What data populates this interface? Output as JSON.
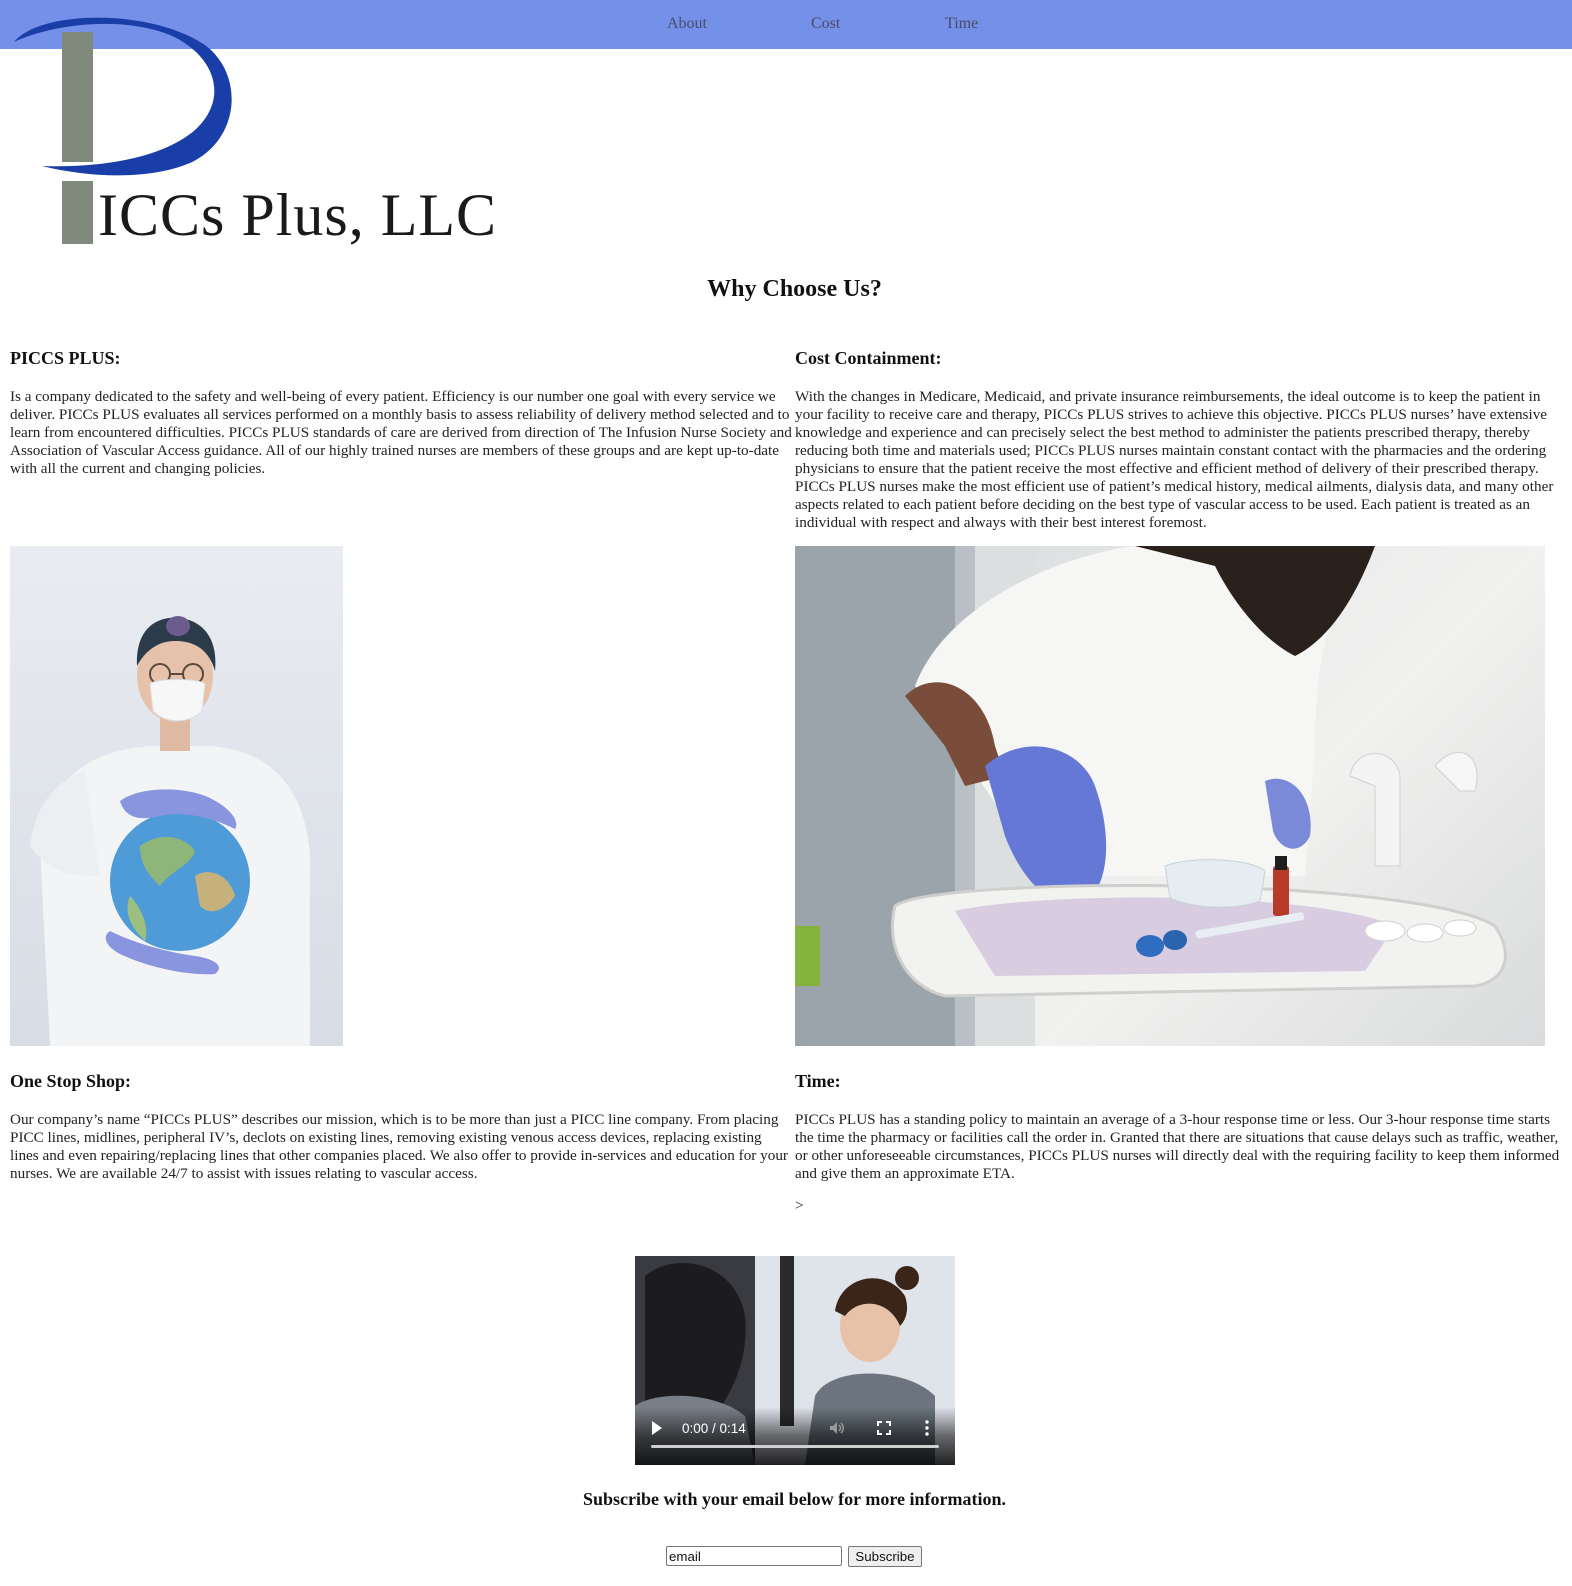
{
  "nav": {
    "about_label": "About",
    "cost_label": "Cost",
    "time_label": "Time"
  },
  "logo": {
    "text": "ICCs Plus, LLC",
    "colors": {
      "swoosh": "#1a3ea8",
      "bar": "#7f8a7d"
    }
  },
  "page": {
    "heading": "Why Choose Us?"
  },
  "sections": {
    "piccs_plus": {
      "title": "PICCS PLUS:",
      "body": "Is a company dedicated to the safety and well-being of every patient. Efficiency is our number one goal with every service we deliver. PICCs PLUS evaluates all services performed on a monthly basis to assess reliability of delivery method selected and to learn from encountered difficulties. PICCs PLUS standards of care are derived from direction of The Infusion Nurse Society and Association of Vascular Access guidance. All of our highly trained nurses are members of these groups and are kept up-to-date with all the current and changing policies."
    },
    "cost": {
      "title": "Cost Containment:",
      "body": "With the changes in Medicare, Medicaid, and private insurance reimbursements, the ideal outcome is to keep the patient in your facility to receive care and therapy, PICCs PLUS strives to achieve this objective. PICCs PLUS nurses’ have extensive knowledge and experience and can precisely select the best method to administer the patients prescribed therapy, thereby reducing both time and materials used; PICCs PLUS nurses maintain constant contact with the pharmacies and the ordering physicians to ensure that the patient receive the most effective and efficient method of delivery of their prescribed therapy. PICCs PLUS nurses make the most efficient use of patient’s medical history, medical ailments, dialysis data, and many other aspects related to each patient before deciding on the best type of vascular access to be used. Each patient is treated as an individual with respect and always with their best interest foremost."
    },
    "one_stop": {
      "title": "One Stop Shop:",
      "body": "Our company’s name “PICCs PLUS” describes our mission, which is to be more than just a PICC line company. From placing PICC lines, midlines, peripheral IV’s, declots on existing lines, removing existing venous access devices, replacing existing lines and even repairing/replacing lines that other companies placed. We also offer to provide in-services and education for your nurses. We are available 24/7 to assist with issues relating to vascular access."
    },
    "time": {
      "title": "Time:",
      "body": "PICCs PLUS has a standing policy to maintain an average of a 3-hour response time or less. Our 3-hour response time starts the time the pharmacy or facilities call the order in. Granted that there are situations that cause delays such as traffic, weather, or other unforeseeable circumstances, PICCs PLUS nurses will directly deal with the requiring facility to keep them informed and give them an approximate ETA.",
      "stray": ">"
    }
  },
  "video": {
    "time_display": "0:00 / 0:14",
    "icons": [
      "play-icon",
      "volume-icon",
      "fullscreen-icon",
      "more-options-icon"
    ]
  },
  "subscribe": {
    "heading": "Subscribe with your email below for more information.",
    "input_value": "email",
    "button_label": "Subscribe"
  },
  "colors": {
    "nav_bg": "#7590e8",
    "nav_text": "#4a4a6a"
  }
}
